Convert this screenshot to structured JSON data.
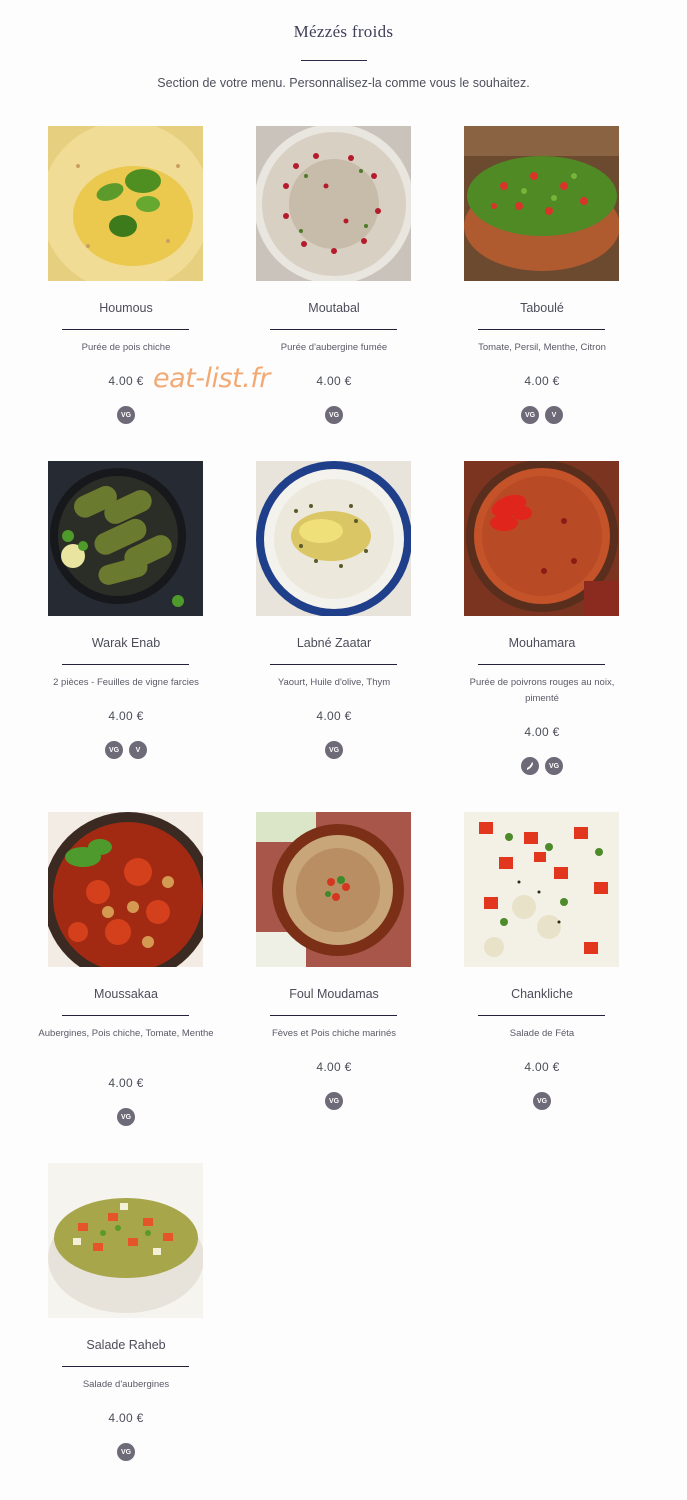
{
  "section": {
    "title": "Mézzés froids",
    "description": "Section de votre menu. Personnalisez-la comme vous le souhaitez."
  },
  "watermark": "eat-list.fr",
  "dishes": [
    {
      "name": "Houmous",
      "description": "Purée de pois chiche",
      "price": "4.00 €",
      "badges": [
        "VG"
      ]
    },
    {
      "name": "Moutabal",
      "description": "Purée d'aubergine fumée",
      "price": "4.00 €",
      "badges": [
        "VG"
      ]
    },
    {
      "name": "Taboulé",
      "description": "Tomate, Persil, Menthe, Citron",
      "price": "4.00 €",
      "badges": [
        "VG",
        "V"
      ]
    },
    {
      "name": "Warak Enab",
      "description": "2 pièces - Feuilles de vigne farcies",
      "price": "4.00 €",
      "badges": [
        "VG",
        "V"
      ]
    },
    {
      "name": "Labné Zaatar",
      "description": "Yaourt, Huile d'olive, Thym",
      "price": "4.00 €",
      "badges": [
        "VG"
      ]
    },
    {
      "name": "Mouhamara",
      "description": "Purée de poivrons rouges au noix, pimenté",
      "price": "4.00 €",
      "badges": [
        "pepper-icon",
        "VG"
      ]
    },
    {
      "name": "Moussakaa",
      "description": "Aubergines, Pois chiche, Tomate, Menthe",
      "price": "4.00 €",
      "badges": [
        "VG"
      ]
    },
    {
      "name": "Foul Moudamas",
      "description": "Fèves et Pois chiche marinés",
      "price": "4.00 €",
      "badges": [
        "VG"
      ]
    },
    {
      "name": "Chankliche",
      "description": "Salade de Féta",
      "price": "4.00 €",
      "badges": [
        "VG"
      ]
    },
    {
      "name": "Salade Raheb",
      "description": "Salade d'aubergines",
      "price": "4.00 €",
      "badges": [
        "VG"
      ]
    }
  ]
}
